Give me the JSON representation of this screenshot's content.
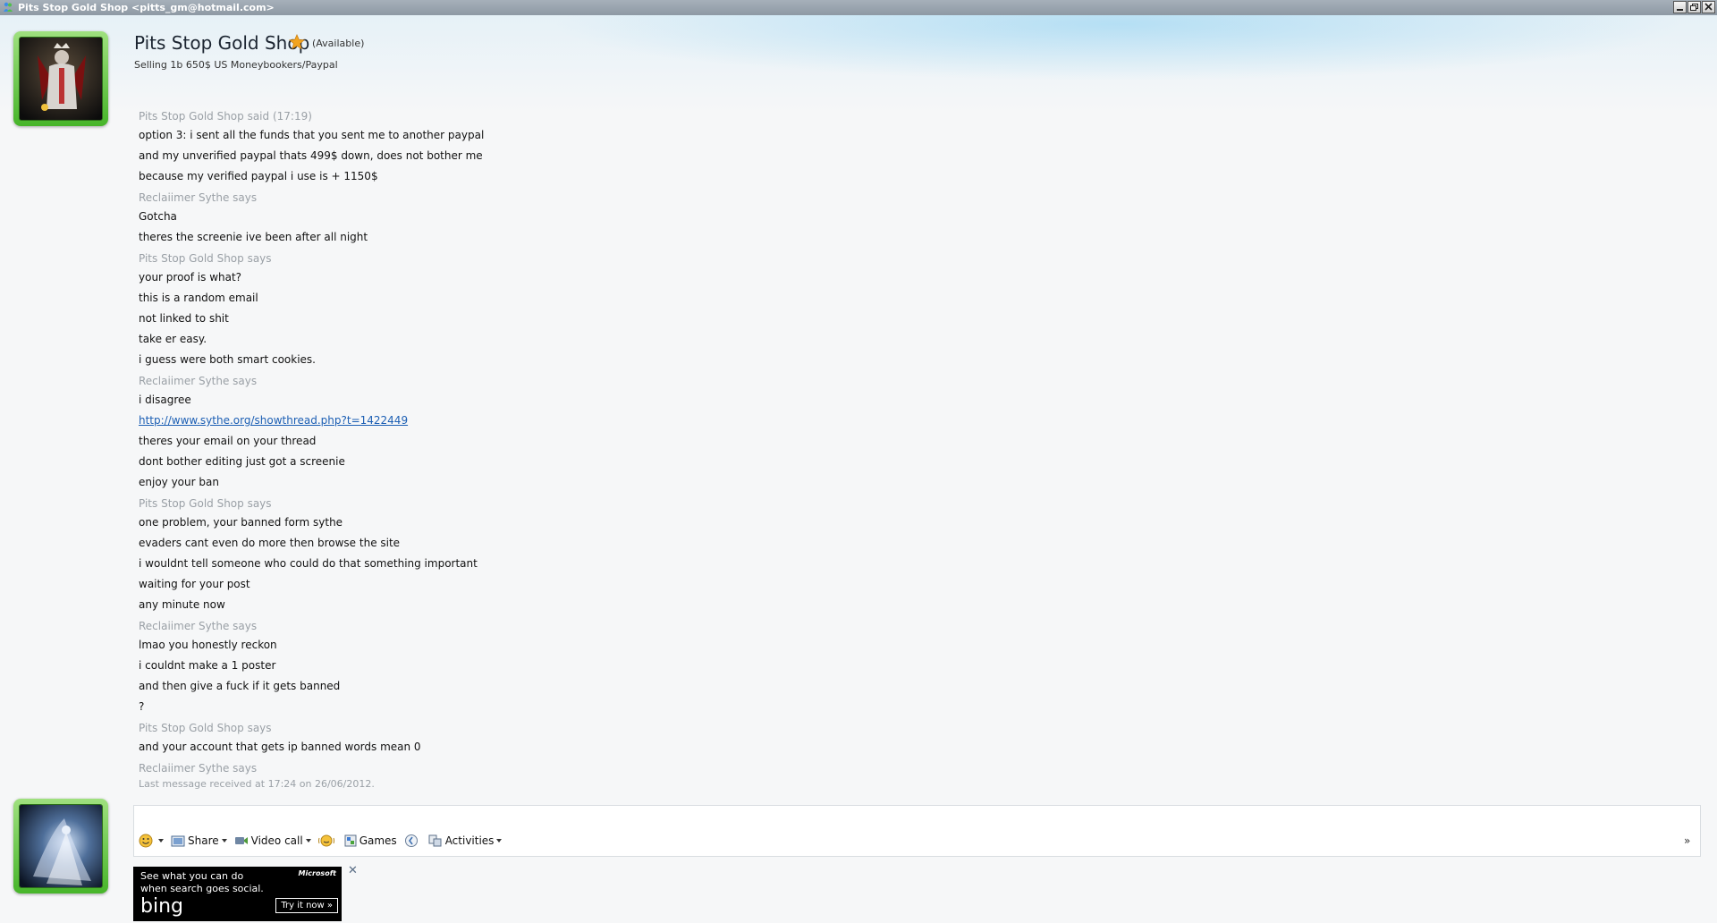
{
  "window": {
    "title": "Pits Stop Gold Shop <pitts_gm@hotmail.com>"
  },
  "contact": {
    "name": "Pits Stop Gold Shop",
    "status": "(Available)",
    "personal_message": "Selling 1b 650$ US Moneybookers/Paypal"
  },
  "conversation": [
    {
      "sender": "Pits Stop Gold Shop said (17:19)",
      "lines": [
        "option 3: i sent all the funds that you sent me to another paypal",
        "and my unverified paypal thats 499$ down, does not bother me",
        "because my verified paypal i use is + 1150$"
      ]
    },
    {
      "sender": "Reclaiimer Sythe says",
      "lines": [
        "Gotcha",
        "theres the screenie ive been after all night"
      ]
    },
    {
      "sender": "Pits Stop Gold Shop says",
      "lines": [
        "your proof is what?",
        "this is a random email",
        "not linked to shit",
        "take er easy.",
        "i guess were both smart cookies."
      ]
    },
    {
      "sender": "Reclaiimer Sythe says",
      "lines": [
        "i disagree",
        {
          "link": "http://www.sythe.org/showthread.php?t=1422449"
        },
        "theres your email on your thread",
        "dont bother editing just got a screenie",
        "enjoy your ban"
      ]
    },
    {
      "sender": "Pits Stop Gold Shop says",
      "lines": [
        "one problem, your banned form sythe",
        "evaders cant even do more then browse the site",
        "i wouldnt tell someone who could do that something important",
        "waiting for your post",
        "any minute now"
      ]
    },
    {
      "sender": "Reclaiimer Sythe says",
      "lines": [
        "lmao you honestly reckon",
        "i couldnt make a 1 poster",
        "and then give a fuck if it gets banned",
        "?"
      ]
    },
    {
      "sender": "Pits Stop Gold Shop says",
      "lines": [
        "and your account that gets ip banned words mean 0"
      ]
    },
    {
      "sender": "Reclaiimer Sythe says",
      "lines": []
    }
  ],
  "last_message": "Last message received at 17:24 on 26/06/2012.",
  "toolbar": {
    "share": "Share",
    "video_call": "Video call",
    "games": "Games",
    "activities": "Activities",
    "expand": "»"
  },
  "ad": {
    "text_line1": "See what you can do",
    "text_line2": "when search goes social.",
    "brand": "bing",
    "microsoft": "Microsoft",
    "cta": "Try it now »",
    "close": "✕"
  },
  "colors": {
    "avatar_frame": "#47b52a",
    "sender_grey": "#9aa0a6",
    "link": "#1c5fb4"
  }
}
